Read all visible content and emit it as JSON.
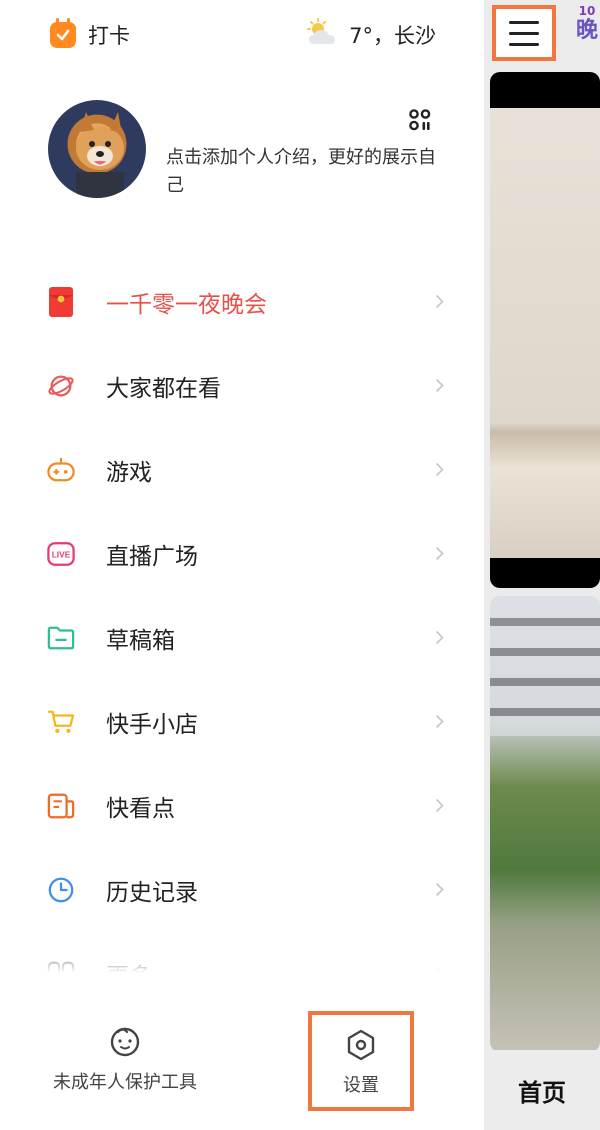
{
  "header": {
    "checkin_label": "打卡",
    "weather_label": "7°，长沙",
    "weather_icon": "partly-cloudy-icon"
  },
  "profile": {
    "bio": "点击添加个人介绍，更好的展示自己"
  },
  "menu": {
    "items": [
      {
        "label": "一千零一夜晚会",
        "icon": "red-envelope-icon",
        "highlight": true
      },
      {
        "label": "大家都在看",
        "icon": "planet-icon"
      },
      {
        "label": "游戏",
        "icon": "gamepad-icon"
      },
      {
        "label": "直播广场",
        "icon": "live-icon",
        "badge": "LIVE"
      },
      {
        "label": "草稿箱",
        "icon": "folder-icon"
      },
      {
        "label": "快手小店",
        "icon": "shopping-cart-icon"
      },
      {
        "label": "快看点",
        "icon": "news-icon"
      },
      {
        "label": "历史记录",
        "icon": "clock-icon"
      },
      {
        "label": "更多",
        "icon": "more-icon"
      }
    ]
  },
  "bottom": {
    "teen_label": "未成年人保护工具",
    "settings_label": "设置"
  },
  "peek": {
    "badge_number": "10",
    "badge_char": "晚",
    "home_tab_label": "首页"
  },
  "colors": {
    "accent_orange": "#ff8a1f",
    "highlight_red": "#e8504a",
    "annotation_border": "#f0773f"
  }
}
